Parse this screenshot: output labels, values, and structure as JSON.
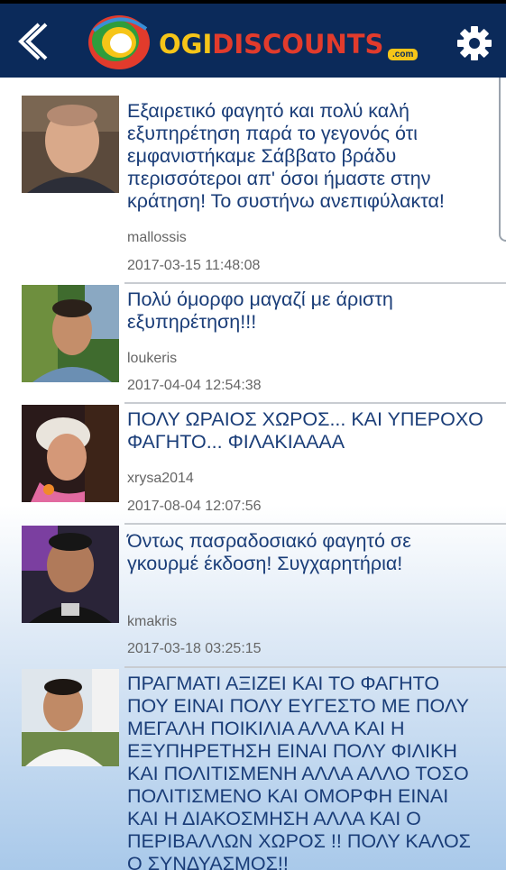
{
  "header": {
    "logo_ogi": "OGI",
    "logo_discounts": "DISCOUNTS",
    "logo_com": ".com",
    "back_icon": "chevron-left-icon",
    "settings_icon": "gear-icon"
  },
  "reviews": [
    {
      "text": "Εξαιρετικό φαγητό και πολύ καλή εξυπηρέτηση παρά το γεγονός ότι εμφανιστήκαμε Σάββατο βράδυ περισσότεροι απ' όσοι ήμαστε στην κράτηση! Το συστήνω ανεπιφύλακτα!",
      "user": "mallossis",
      "date": "2017-03-15 11:48:08"
    },
    {
      "text": "Πολύ όμορφο μαγαζί με άριστη εξυπηρέτηση!!!",
      "user": "loukeris",
      "date": "2017-04-04 12:54:38"
    },
    {
      "text": "ΠΟΛΥ ΩΡΑΙΟΣ ΧΩΡΟΣ... ΚΑΙ ΥΠΕΡΟΧΟ ΦΑΓΗΤΟ... ΦΙΛΑΚΙΑΑΑΑ",
      "user": "xrysa2014",
      "date": "2017-08-04 12:07:56"
    },
    {
      "text": "Όντως πασραδοσιακό φαγητό σε γκουρμέ έκδοση! Συγχαρητήρια!",
      "user": "kmakris",
      "date": "2017-03-18 03:25:15"
    },
    {
      "text": "ΠΡΑΓΜΑΤΙ ΑΞΙΖΕΙ ΚΑΙ ΤΟ ΦΑΓΗΤΟ ΠΟΥ ΕΙΝΑΙ ΠΟΛΥ ΕΥΓΕΣΤΟ ΜΕ ΠΟΛΥ ΜΕΓΑΛΗ ΠΟΙΚΙΛΙΑ ΑΛΛΑ ΚΑΙ Η ΕΞΥΠΗΡΕΤΗΣΗ ΕΙΝΑΙ ΠΟΛΥ ΦΙΛΙΚΗ ΚΑΙ ΠΟΛΙΤΙΣΜΕΝΗ ΑΛΛΑ ΑΛΛΟ ΤΟΣΟ ΠΟΛΙΤΙΣΜΕΝΟ ΚΑΙ ΟΜΟΡΦΗ ΕΙΝΑΙ ΚΑΙ Η ΔΙΑΚΟΣΜΗΣΗ ΑΛΛΑ ΚΑΙ Ο ΠΕΡΙΒΑΛΛΩΝ ΧΩΡΟΣ !! ΠΟΛΥ ΚΑΛΟΣ Ο ΣΥΝΔΥΑΣΜΟΣ!!"
    }
  ],
  "colors": {
    "header_bg": "#0b2a5a",
    "review_text": "#1a3d78",
    "meta_text": "#666666"
  }
}
